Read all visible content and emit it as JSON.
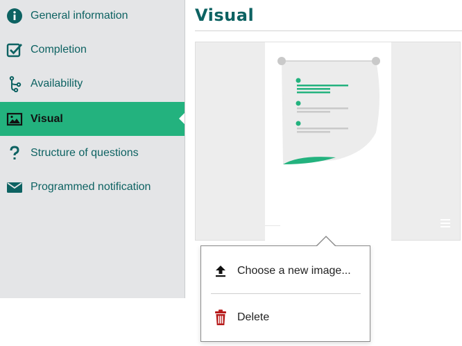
{
  "sidebar": {
    "items": [
      {
        "label": "General information",
        "icon": "info-icon"
      },
      {
        "label": "Completion",
        "icon": "checkbox-icon"
      },
      {
        "label": "Availability",
        "icon": "branch-icon"
      },
      {
        "label": "Visual",
        "icon": "image-icon",
        "active": true
      },
      {
        "label": "Structure of questions",
        "icon": "question-icon"
      },
      {
        "label": "Programmed notification",
        "icon": "envelope-icon"
      }
    ]
  },
  "main": {
    "title": "Visual"
  },
  "popup_menu": {
    "items": [
      {
        "label": "Choose a new image...",
        "icon": "upload-icon"
      },
      {
        "label": "Delete",
        "icon": "trash-icon"
      }
    ]
  },
  "colors": {
    "accent": "#23b27e",
    "title": "#0d6262",
    "delete": "#b71c1c"
  }
}
